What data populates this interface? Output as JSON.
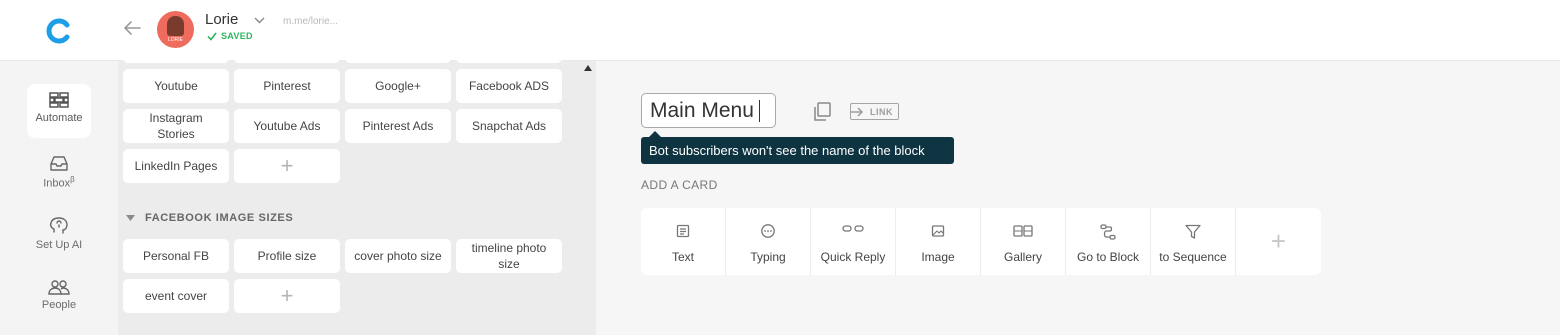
{
  "header": {
    "logo_letter": "C",
    "page_name": "Lorie",
    "avatar_text": "LORIE",
    "saved_label": "SAVED",
    "page_link": "m.me/lorie..."
  },
  "nav": {
    "items": [
      {
        "label": "Automate",
        "icon": "bricks-icon",
        "active": true
      },
      {
        "label": "Inbox",
        "sup": "β",
        "icon": "inbox-icon"
      },
      {
        "label": "Set Up AI",
        "icon": "brain-icon"
      },
      {
        "label": "People",
        "icon": "people-icon"
      }
    ]
  },
  "panel": {
    "social_row1": [
      "Youtube",
      "Pinterest",
      "Google+",
      "Facebook ADS"
    ],
    "social_row2": [
      "Instagram Stories",
      "Youtube Ads",
      "Pinterest Ads",
      "Snapchat Ads"
    ],
    "social_row3": [
      "LinkedIn Pages",
      "+"
    ],
    "fb_section_title": "FACEBOOK IMAGE SIZES",
    "fb_row1": [
      "Personal FB",
      "Profile size",
      "cover photo size",
      "timeline photo size"
    ],
    "fb_row2": [
      "event cover",
      "+"
    ]
  },
  "editor": {
    "block_name": "Main Menu",
    "link_label": "LINK",
    "tooltip": "Bot subscribers won't see the name of the block",
    "add_card_label": "ADD A CARD",
    "cards": [
      "Text",
      "Typing",
      "Quick Reply",
      "Image",
      "Gallery",
      "Go to Block",
      "to Sequence",
      "+"
    ]
  },
  "colors": {
    "brand_blue": "#1e9ee6",
    "saved_green": "#2fb562",
    "tooltip_bg": "#0e3341",
    "avatar_bg": "#ef6b5d"
  }
}
